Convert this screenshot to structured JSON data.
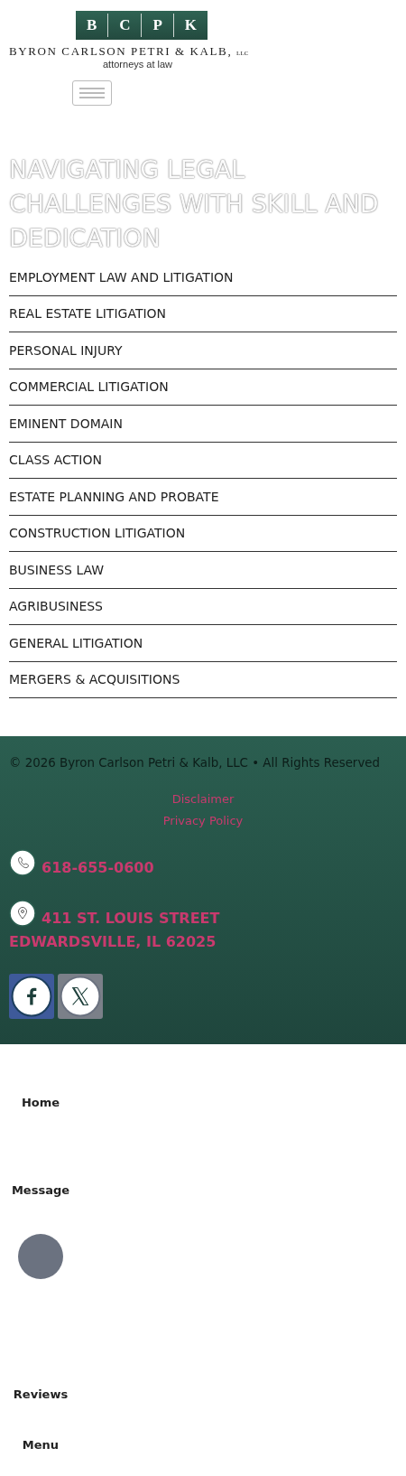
{
  "header": {
    "logo_letters": [
      "B",
      "C",
      "P",
      "K"
    ],
    "firm_name": "BYRON CARLSON PETRI & KALB,",
    "firm_suffix": "LLC",
    "tagline": "attorneys at law"
  },
  "hero": {
    "heading": "NAVIGATING LEGAL CHALLENGES WITH SKILL AND DEDICATION"
  },
  "practice_areas": [
    {
      "label": "EMPLOYMENT LAW AND LITIGATION"
    },
    {
      "label": "REAL ESTATE LITIGATION"
    },
    {
      "label": "PERSONAL INJURY"
    },
    {
      "label": "COMMERCIAL LITIGATION"
    },
    {
      "label": "EMINENT DOMAIN"
    },
    {
      "label": "CLASS ACTION"
    },
    {
      "label": "ESTATE PLANNING AND PROBATE"
    },
    {
      "label": "CONSTRUCTION LITIGATION"
    },
    {
      "label": "BUSINESS LAW"
    },
    {
      "label": "AGRIBUSINESS"
    },
    {
      "label": "GENERAL LITIGATION"
    },
    {
      "label": "MERGERS & ACQUISITIONS"
    }
  ],
  "footer": {
    "copyright": "© 2026 Byron Carlson Petri & Kalb, LLC • All Rights Reserved",
    "links": [
      "Disclaimer",
      "Privacy Policy"
    ],
    "contacts": [
      {
        "kind": "phone",
        "lines": [
          "618-655-0600"
        ]
      },
      {
        "kind": "location",
        "lines": [
          "411 ST. LOUIS STREET",
          "EDWARDSVILLE, IL 62025"
        ]
      }
    ],
    "social": [
      {
        "kind": "facebook"
      },
      {
        "kind": "x"
      }
    ]
  },
  "bottom_nav": [
    {
      "kind": "label",
      "label": "Home"
    },
    {
      "kind": "label",
      "label": "Message"
    },
    {
      "kind": "circle"
    },
    {
      "kind": "label",
      "label": "Reviews"
    },
    {
      "kind": "label",
      "label": "Menu"
    }
  ]
}
